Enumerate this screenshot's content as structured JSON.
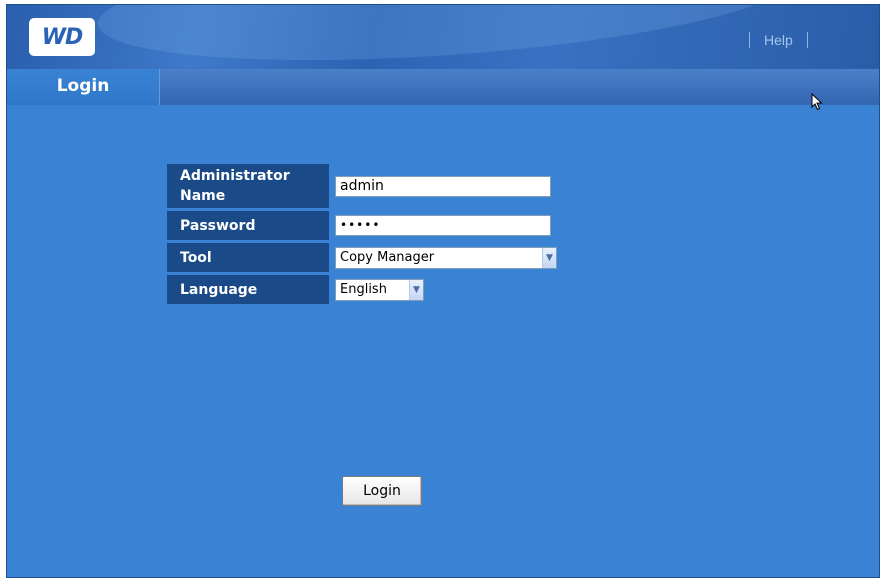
{
  "header": {
    "logo_text": "WD",
    "help_label": "Help"
  },
  "tabs": {
    "active_label": "Login"
  },
  "form": {
    "admin_label": "Administrator Name",
    "admin_value": "admin",
    "password_label": "Password",
    "password_value": "•••••",
    "tool_label": "Tool",
    "tool_selected": "Copy Manager",
    "language_label": "Language",
    "language_selected": "English",
    "submit_label": "Login"
  },
  "icons": {
    "dropdown": "chevron-down-icon",
    "pointer": "cursor-arrow-icon"
  },
  "colors": {
    "page_bg": "#3a82d3",
    "label_bg": "#1a4a88",
    "header_bg": "#2d63b3"
  }
}
